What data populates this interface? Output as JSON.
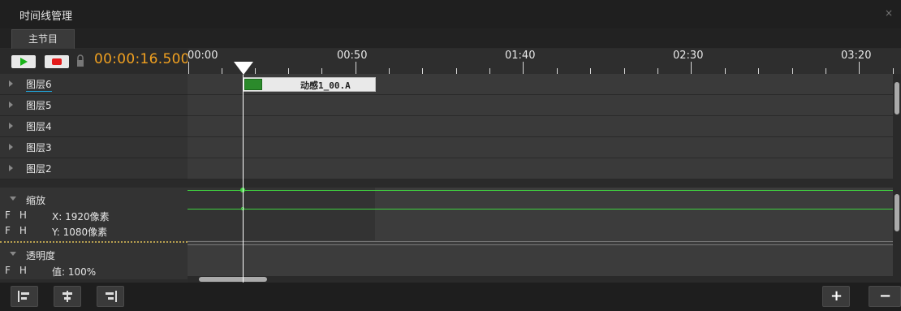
{
  "window": {
    "title": "时间线管理",
    "close_label": "×"
  },
  "tabs": [
    {
      "label": "主节目"
    }
  ],
  "transport": {
    "timecode": "00:00:16.500"
  },
  "ruler": {
    "labels": [
      "00:00",
      "00:50",
      "01:40",
      "02:30",
      "03:20"
    ]
  },
  "layers": [
    {
      "label": "图层6"
    },
    {
      "label": "图层5"
    },
    {
      "label": "图层4"
    },
    {
      "label": "图层3"
    },
    {
      "label": "图层2"
    }
  ],
  "clip": {
    "label": "动感1_00.A"
  },
  "properties": {
    "scale": {
      "label": "缩放",
      "x": {
        "flags": "FH",
        "value": "X: 1920像素"
      },
      "y": {
        "flags": "FH",
        "value": "Y: 1080像素"
      }
    },
    "opacity": {
      "label": "透明度",
      "value": {
        "flags": "FH",
        "value": "值: 100%"
      }
    }
  },
  "toolbar": {
    "add_label": "+",
    "remove_label": "−"
  },
  "colors": {
    "timecode": "#f0a020",
    "play": "#19b319",
    "record": "#e31a1a",
    "keyframe_line": "#3fd23f",
    "active_underline": "#20a8e0"
  }
}
